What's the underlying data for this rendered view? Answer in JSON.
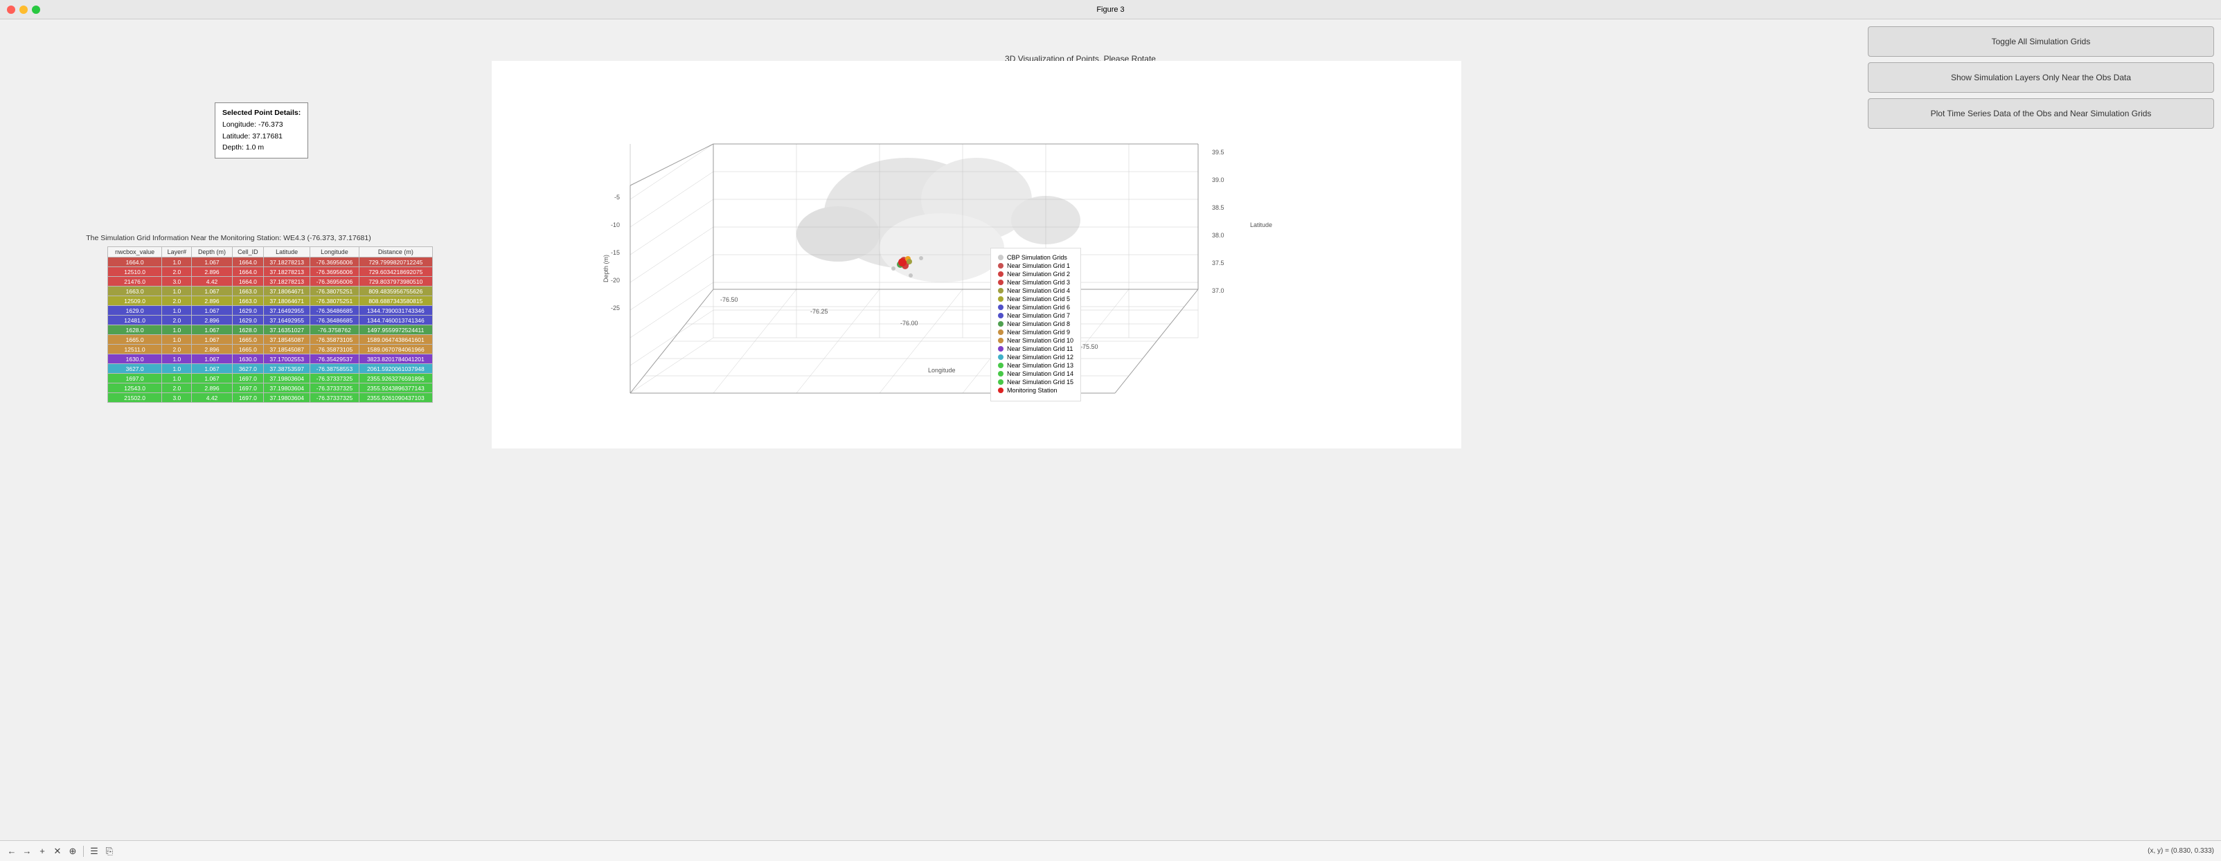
{
  "window": {
    "title": "Figure 3"
  },
  "selected_point": {
    "title": "Selected Point Details:",
    "longitude_label": "Longitude: -76.373",
    "latitude_label": "Latitude: 37.17681",
    "depth_label": "Depth: 1.0 m"
  },
  "grid_info_title": "The Simulation Grid Information Near the Monitoring Station: WE4.3 (-76.373, 37.17681)",
  "plot_title": "3D Visualization of Points, Please Rotate",
  "table": {
    "headers": [
      "nwcbox_value",
      "Layer#",
      "Depth (m)",
      "Cell_ID",
      "Latitude",
      "Longitude",
      "Distance (m)"
    ],
    "rows": [
      {
        "nwcbox": "1664.0",
        "layer": "1.0",
        "depth": "1.067",
        "cell": "1664.0",
        "lat": "37.18278213",
        "lon": "-76.36956006",
        "dist": "729.7999820712245",
        "bg": "#c8504a"
      },
      {
        "nwcbox": "12510.0",
        "layer": "2.0",
        "depth": "2.896",
        "cell": "1664.0",
        "lat": "37.18278213",
        "lon": "-76.36956006",
        "dist": "729.6034218692075",
        "bg": "#d44a4a"
      },
      {
        "nwcbox": "21476.0",
        "layer": "3.0",
        "depth": "4.42",
        "cell": "1664.0",
        "lat": "37.18278213",
        "lon": "-76.36956006",
        "dist": "729.8037973980510",
        "bg": "#d44a4a"
      },
      {
        "nwcbox": "1663.0",
        "layer": "1.0",
        "depth": "1.067",
        "cell": "1663.0",
        "lat": "37.18064671",
        "lon": "-76.38075251",
        "dist": "809.4835956755626",
        "bg": "#a0a040"
      },
      {
        "nwcbox": "12509.0",
        "layer": "2.0",
        "depth": "2.896",
        "cell": "1663.0",
        "lat": "37.18064671",
        "lon": "-76.38075251",
        "dist": "808.6887343580815",
        "bg": "#a8a830"
      },
      {
        "nwcbox": "1629.0",
        "layer": "1.0",
        "depth": "1.067",
        "cell": "1629.0",
        "lat": "37.16492955",
        "lon": "-76.36486685",
        "dist": "1344.7390031743346",
        "bg": "#5050c8"
      },
      {
        "nwcbox": "12481.0",
        "layer": "2.0",
        "depth": "2.896",
        "cell": "1629.0",
        "lat": "37.16492955",
        "lon": "-76.36486685",
        "dist": "1344.7460013741346",
        "bg": "#5050c8"
      },
      {
        "nwcbox": "1628.0",
        "layer": "1.0",
        "depth": "1.067",
        "cell": "1628.0",
        "lat": "37.16351027",
        "lon": "-76.3758762",
        "dist": "1497.9559972524411",
        "bg": "#50a050"
      },
      {
        "nwcbox": "1665.0",
        "layer": "1.0",
        "depth": "1.067",
        "cell": "1665.0",
        "lat": "37.18545087",
        "lon": "-76.35873105",
        "dist": "1589.0647438641601",
        "bg": "#c89040"
      },
      {
        "nwcbox": "12511.0",
        "layer": "2.0",
        "depth": "2.896",
        "cell": "1665.0",
        "lat": "37.18545087",
        "lon": "-76.35873105",
        "dist": "1589.0670784061966",
        "bg": "#c89040"
      },
      {
        "nwcbox": "1630.0",
        "layer": "1.0",
        "depth": "1.067",
        "cell": "1630.0",
        "lat": "37.17002553",
        "lon": "-76.35429537",
        "dist": "3823.8201784041201",
        "bg": "#8040c8"
      },
      {
        "nwcbox": "3627.0",
        "layer": "1.0",
        "depth": "1.067",
        "cell": "3627.0",
        "lat": "37.38753597",
        "lon": "-76.38758553",
        "dist": "2061.5920061037948",
        "bg": "#40b0c8"
      },
      {
        "nwcbox": "1697.0",
        "layer": "1.0",
        "depth": "1.067",
        "cell": "1697.0",
        "lat": "37.19803604",
        "lon": "-76.37337325",
        "dist": "2355.9263276591896",
        "bg": "#48c848"
      },
      {
        "nwcbox": "12543.0",
        "layer": "2.0",
        "depth": "2.896",
        "cell": "1697.0",
        "lat": "37.19803604",
        "lon": "-76.37337325",
        "dist": "2355.9243896377143",
        "bg": "#48c848"
      },
      {
        "nwcbox": "21502.0",
        "layer": "3.0",
        "depth": "4.42",
        "cell": "1697.0",
        "lat": "37.19803604",
        "lon": "-76.37337325",
        "dist": "2355.9261090437103",
        "bg": "#48c848"
      }
    ]
  },
  "legend": {
    "items": [
      {
        "label": "CBP Simulation Grids",
        "color": "#cccccc",
        "type": "dot"
      },
      {
        "label": "Near Simulation Grid 1",
        "color": "#c85050",
        "type": "dot"
      },
      {
        "label": "Near Simulation Grid 2",
        "color": "#d04040",
        "type": "dot"
      },
      {
        "label": "Near Simulation Grid 3",
        "color": "#d04040",
        "type": "dot"
      },
      {
        "label": "Near Simulation Grid 4",
        "color": "#a0a040",
        "type": "dot"
      },
      {
        "label": "Near Simulation Grid 5",
        "color": "#a8a830",
        "type": "dot"
      },
      {
        "label": "Near Simulation Grid 6",
        "color": "#5050c8",
        "type": "dot"
      },
      {
        "label": "Near Simulation Grid 7",
        "color": "#5050c8",
        "type": "dot"
      },
      {
        "label": "Near Simulation Grid 8",
        "color": "#50a050",
        "type": "dot"
      },
      {
        "label": "Near Simulation Grid 9",
        "color": "#c89040",
        "type": "dot"
      },
      {
        "label": "Near Simulation Grid 10",
        "color": "#c89040",
        "type": "dot"
      },
      {
        "label": "Near Simulation Grid 11",
        "color": "#8040c8",
        "type": "dot"
      },
      {
        "label": "Near Simulation Grid 12",
        "color": "#40b0c8",
        "type": "dot"
      },
      {
        "label": "Near Simulation Grid 13",
        "color": "#48c848",
        "type": "dot"
      },
      {
        "label": "Near Simulation Grid 14",
        "color": "#48c848",
        "type": "dot"
      },
      {
        "label": "Near Simulation Grid 15",
        "color": "#48c848",
        "type": "dot"
      },
      {
        "label": "Monitoring Station",
        "color": "#dd2222",
        "type": "dot"
      }
    ]
  },
  "buttons": {
    "toggle_grids": "Toggle All Simulation Grids",
    "show_layers": "Show Simulation Layers Only Near the Obs Data",
    "plot_time_series": "Plot Time Series Data of the Obs and Near Simulation Grids"
  },
  "toolbar": {
    "icons": [
      "←",
      "→",
      "+",
      "✕",
      "⊕",
      "☰",
      "⎘"
    ],
    "coords": "(x, y) = (0.830, 0.333)"
  }
}
